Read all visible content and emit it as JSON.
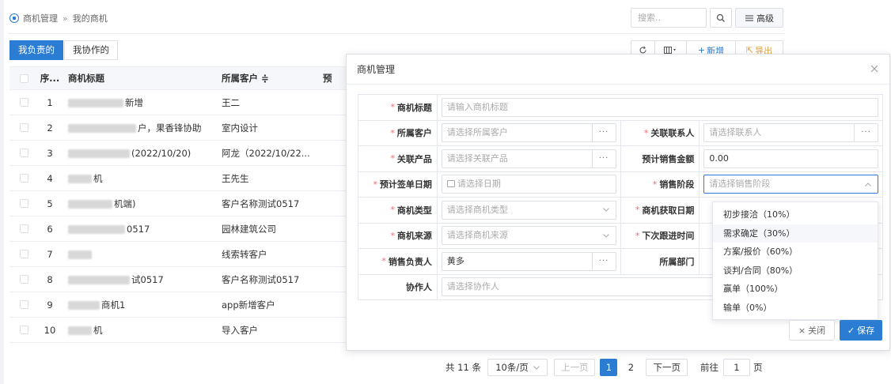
{
  "breadcrumb": {
    "root": "商机管理",
    "separator": "»",
    "current": "我的商机"
  },
  "search": {
    "placeholder": "搜索..",
    "advanced_label": "高级"
  },
  "tabs": [
    {
      "label": "我负责的"
    },
    {
      "label": "我协作的"
    }
  ],
  "toolbar": {
    "add_label": "新增",
    "export_label": "导出"
  },
  "table": {
    "columns": {
      "index": "序...",
      "title": "商机标题",
      "customer": "所属客户 ≑",
      "truncated": "预"
    },
    "rows": [
      {
        "no": "1",
        "title": "新增",
        "customer": "王二"
      },
      {
        "no": "2",
        "title": "户，果香锋协助",
        "customer": "室内设计"
      },
      {
        "no": "3",
        "title": "(2022/10/20)",
        "customer": "阿龙（2022/10/22..."
      },
      {
        "no": "4",
        "title": "机",
        "customer": "王先生"
      },
      {
        "no": "5",
        "title": "机端)",
        "customer": "客户名称测试0517"
      },
      {
        "no": "6",
        "title": "0517",
        "customer": "园林建筑公司"
      },
      {
        "no": "7",
        "title": "",
        "customer": "线索转客户"
      },
      {
        "no": "8",
        "title": "试0517",
        "customer": "客户名称测试0517"
      },
      {
        "no": "9",
        "title": "商机1",
        "customer": "app新增客户"
      },
      {
        "no": "10",
        "title": "机",
        "customer": "导入客户"
      }
    ]
  },
  "pagination": {
    "total": "共 11 条",
    "page_size": "10条/页",
    "prev": "上一页",
    "pages": [
      "1",
      "2"
    ],
    "next": "下一页",
    "goto_prefix": "前往",
    "goto_value": "1",
    "goto_suffix": "页"
  },
  "modal": {
    "title": "商机管理",
    "fields": {
      "title_label": "商机标题",
      "title_placeholder": "请输入商机标题",
      "customer_label": "所属客户",
      "customer_placeholder": "请选择所属客户",
      "contact_label": "关联联系人",
      "contact_placeholder": "请选择联系人",
      "product_label": "关联产品",
      "product_placeholder": "请选择关联产品",
      "amount_label": "预计销售金额",
      "amount_value": "0.00",
      "sign_date_label": "预计签单日期",
      "sign_date_placeholder": "请选择日期",
      "stage_label": "销售阶段",
      "stage_placeholder": "请选择销售阶段",
      "type_label": "商机类型",
      "type_placeholder": "请选择商机类型",
      "acquire_date_label": "商机获取日期",
      "source_label": "商机来源",
      "source_placeholder": "请选择商机来源",
      "next_follow_label": "下次跟进时间",
      "owner_label": "销售负责人",
      "owner_value": "黄多",
      "dept_label": "所属部门",
      "collab_label": "协作人",
      "collab_placeholder": "请选择协作人"
    },
    "stage_options": [
      "初步接洽（10%）",
      "需求确定（30%）",
      "方案/报价（60%）",
      "谈判/合同（80%）",
      "赢单（100%）",
      "输单（0%）"
    ],
    "close_label": "关闭",
    "save_label": "保存"
  },
  "colors": {
    "primary": "#2b7cd3",
    "required": "#f56c6c"
  }
}
